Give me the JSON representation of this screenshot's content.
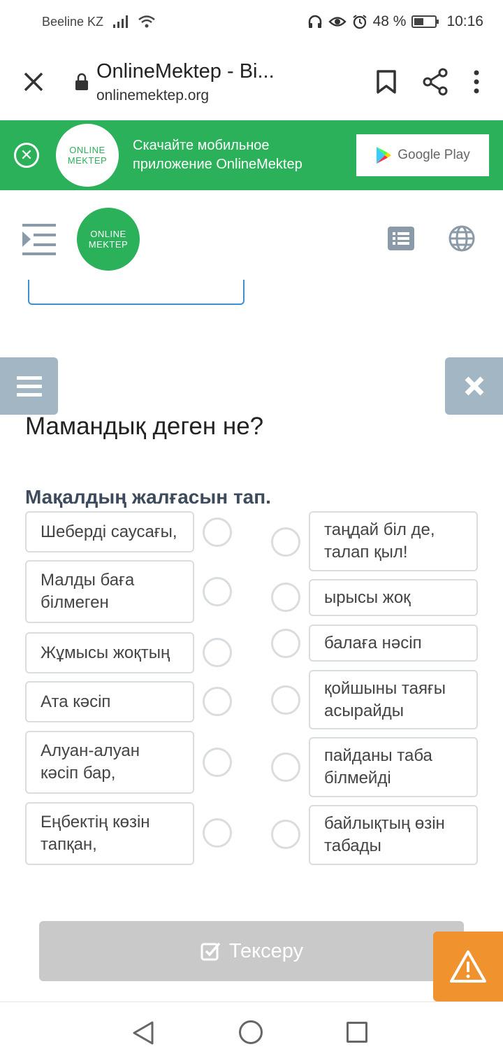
{
  "status_bar": {
    "carrier": "Beeline KZ",
    "battery_percent": "48 %",
    "battery_level": 0.48,
    "time": "10:16"
  },
  "browser": {
    "page_title": "OnlineMektep - Bi...",
    "url": "onlinemektep.org"
  },
  "banner": {
    "logo_line1": "ONLINE",
    "logo_line2": "MEKTEP",
    "text": "Скачайте мобильное приложение OnlineMektep",
    "store_label": "Google Play"
  },
  "site_header": {
    "logo_line1": "ONLINE",
    "logo_line2": "MEKTEP"
  },
  "question": {
    "title": "Мамандық деген не?",
    "instruction": "Мақалдың жалғасын тап.",
    "left_items": [
      "Шеберді саусағы,",
      "Малды баға білмеген",
      "Жұмысы жоқтың",
      "Ата кәсіп",
      "Алуан-алуан кәсіп бар,",
      "Еңбектің көзін тапқан,"
    ],
    "right_items": [
      "таңдай біл де, талап қыл!",
      "ырысы жоқ",
      "балаға нәсіп",
      "қойшыны таяғы асырайды",
      "пайданы таба білмейді",
      "байлықтың өзін табады"
    ]
  },
  "actions": {
    "check_label": "Тексеру"
  },
  "colors": {
    "brand_green": "#2bb15a",
    "side_button": "#a3b6c4",
    "warning_orange": "#f0922d",
    "disabled_button": "#c9c9c9"
  }
}
